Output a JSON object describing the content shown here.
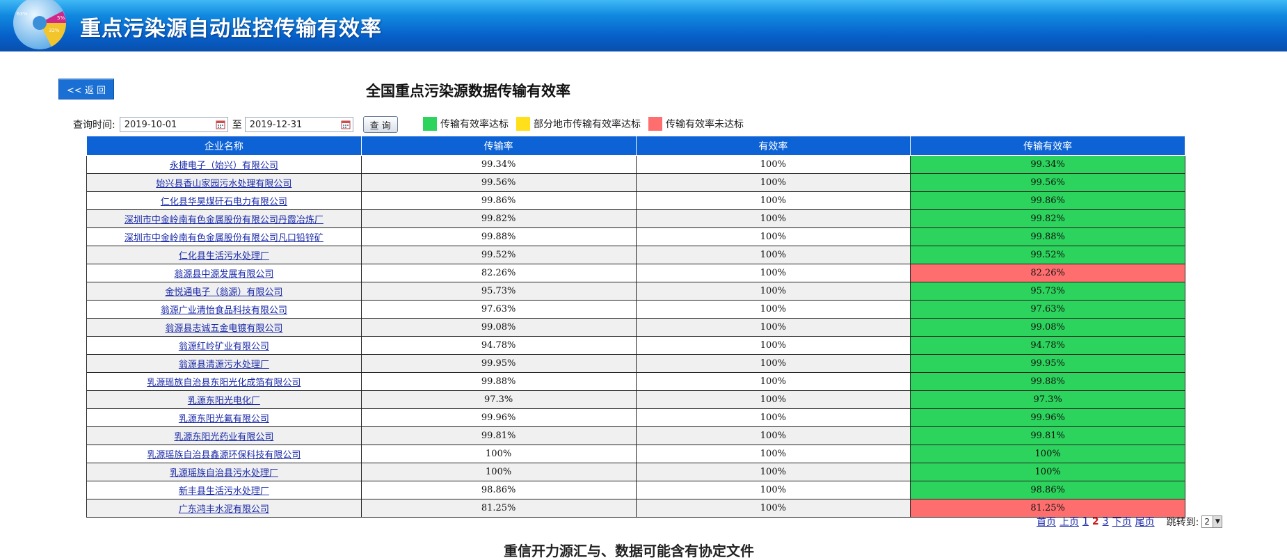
{
  "header": {
    "title": "重点污染源自动监控传输有效率",
    "logo_labels": [
      "63%",
      "5%",
      "32%"
    ],
    "colors": {
      "banner": "#0660c9"
    }
  },
  "back_button": "<< 返 回",
  "page_heading": "全国重点污染源数据传输有效率",
  "query": {
    "label": "查询时间:",
    "start_date": "2019-10-01",
    "separator": "至",
    "end_date": "2019-12-31",
    "button": "查 询",
    "calendar_icon": "calendar-icon"
  },
  "legend": [
    {
      "label": "传输有效率达标",
      "color": "#2cd35c"
    },
    {
      "label": "部分地市传输有效率达标",
      "color": "#ffe01a"
    },
    {
      "label": "传输有效率未达标",
      "color": "#ff6e6e"
    }
  ],
  "table": {
    "columns": [
      "企业名称",
      "传输率",
      "有效率",
      "传输有效率"
    ],
    "rows": [
      {
        "name": "永捷电子（始兴）有限公司",
        "transmission": "99.34%",
        "validity": "100%",
        "eff": "99.34%",
        "status": "ok"
      },
      {
        "name": "始兴县香山家园污水处理有限公司",
        "transmission": "99.56%",
        "validity": "100%",
        "eff": "99.56%",
        "status": "ok"
      },
      {
        "name": "仁化县华昊煤矸石电力有限公司",
        "transmission": "99.86%",
        "validity": "100%",
        "eff": "99.86%",
        "status": "ok"
      },
      {
        "name": "深圳市中金岭南有色金属股份有限公司丹霞冶炼厂",
        "transmission": "99.82%",
        "validity": "100%",
        "eff": "99.82%",
        "status": "ok"
      },
      {
        "name": "深圳市中金岭南有色金属股份有限公司凡口铅锌矿",
        "transmission": "99.88%",
        "validity": "100%",
        "eff": "99.88%",
        "status": "ok"
      },
      {
        "name": "仁化县生活污水处理厂",
        "transmission": "99.52%",
        "validity": "100%",
        "eff": "99.52%",
        "status": "ok"
      },
      {
        "name": "翁源县中源发展有限公司",
        "transmission": "82.26%",
        "validity": "100%",
        "eff": "82.26%",
        "status": "bad"
      },
      {
        "name": "金悦通电子（翁源）有限公司",
        "transmission": "95.73%",
        "validity": "100%",
        "eff": "95.73%",
        "status": "ok"
      },
      {
        "name": "翁源广业清怡食品科技有限公司",
        "transmission": "97.63%",
        "validity": "100%",
        "eff": "97.63%",
        "status": "ok"
      },
      {
        "name": "翁源县志诚五金电镀有限公司",
        "transmission": "99.08%",
        "validity": "100%",
        "eff": "99.08%",
        "status": "ok"
      },
      {
        "name": "翁源红岭矿业有限公司",
        "transmission": "94.78%",
        "validity": "100%",
        "eff": "94.78%",
        "status": "ok"
      },
      {
        "name": "翁源县清源污水处理厂",
        "transmission": "99.95%",
        "validity": "100%",
        "eff": "99.95%",
        "status": "ok"
      },
      {
        "name": "乳源瑶族自治县东阳光化成箔有限公司",
        "transmission": "99.88%",
        "validity": "100%",
        "eff": "99.88%",
        "status": "ok"
      },
      {
        "name": "乳源东阳光电化厂",
        "transmission": "97.3%",
        "validity": "100%",
        "eff": "97.3%",
        "status": "ok"
      },
      {
        "name": "乳源东阳光氟有限公司",
        "transmission": "99.96%",
        "validity": "100%",
        "eff": "99.96%",
        "status": "ok"
      },
      {
        "name": "乳源东阳光药业有限公司",
        "transmission": "99.81%",
        "validity": "100%",
        "eff": "99.81%",
        "status": "ok"
      },
      {
        "name": "乳源瑶族自治县鑫源环保科技有限公司",
        "transmission": "100%",
        "validity": "100%",
        "eff": "100%",
        "status": "ok"
      },
      {
        "name": "乳源瑶族自治县污水处理厂",
        "transmission": "100%",
        "validity": "100%",
        "eff": "100%",
        "status": "ok"
      },
      {
        "name": "新丰县生活污水处理厂",
        "transmission": "98.86%",
        "validity": "100%",
        "eff": "98.86%",
        "status": "ok"
      },
      {
        "name": "广东鸿丰水泥有限公司",
        "transmission": "81.25%",
        "validity": "100%",
        "eff": "81.25%",
        "status": "bad"
      }
    ]
  },
  "pager": {
    "first": "首页",
    "prev": "上页",
    "pages": [
      "1",
      "2",
      "3"
    ],
    "current": "2",
    "next": "下页",
    "last": "尾页",
    "jump_label": "跳转到:",
    "jump_value": "2"
  },
  "footnote": "重信开力源汇与、数据可能含有协定文件"
}
